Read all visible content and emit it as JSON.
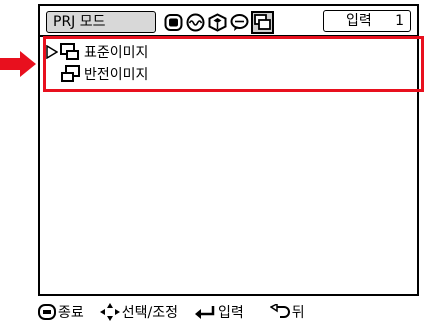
{
  "header": {
    "mode_label": "PRJ 모드",
    "input_label": "입력",
    "input_number": "1"
  },
  "menu_icons": [
    {
      "name": "picture-icon"
    },
    {
      "name": "fine-sync-icon"
    },
    {
      "name": "options-icon"
    },
    {
      "name": "language-icon"
    },
    {
      "name": "projector-mode-icon",
      "active": true
    }
  ],
  "list": {
    "items": [
      {
        "label": "표준이미지",
        "selected": true
      },
      {
        "label": "반전이미지",
        "selected": false
      }
    ]
  },
  "footer": {
    "end_label": "종료",
    "select_label": "선택/조정",
    "enter_label": "입력",
    "back_label": "뒤"
  },
  "colors": {
    "highlight": "#e8101e",
    "tab_bg": "#d8d8d8"
  }
}
